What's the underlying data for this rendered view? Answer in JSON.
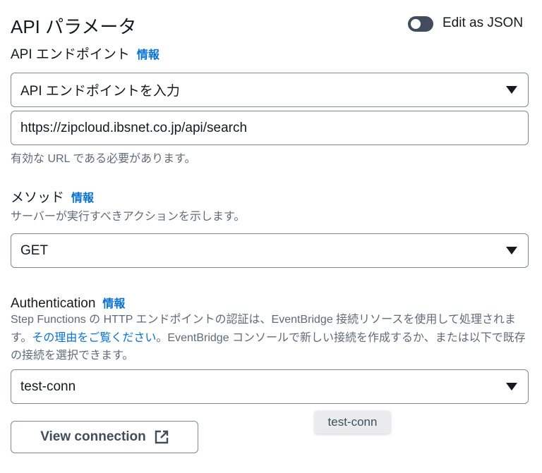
{
  "header": {
    "title": "API パラメータ",
    "toggle_label": "Edit as JSON",
    "toggle_on": false
  },
  "endpoint": {
    "label": "API エンドポイント",
    "info": "情報",
    "select_placeholder": "API エンドポイントを入力",
    "url_value": "https://zipcloud.ibsnet.co.jp/api/search",
    "helper": "有効な URL である必要があります。"
  },
  "method": {
    "label": "メソッド",
    "info": "情報",
    "description": "サーバーが実行すべきアクションを示します。",
    "value": "GET"
  },
  "auth": {
    "label": "Authentication",
    "info": "情報",
    "desc_1": "Step Functions の HTTP エンドポイントの認証は、EventBridge 接続リソースを使用して処理されます。",
    "link": "その理由をご覧ください",
    "desc_2": "。EventBridge コンソールで新しい接続を作成するか、または以下で既存の接続を選択できます。",
    "value": "test-conn",
    "tooltip": "test-conn",
    "view_button": "View connection"
  }
}
